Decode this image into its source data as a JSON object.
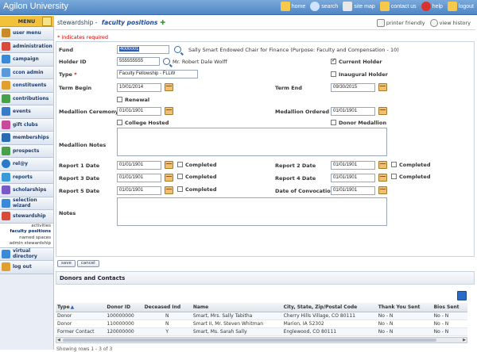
{
  "app": {
    "title": "Agilon University"
  },
  "topnav": [
    {
      "label": "home",
      "icon": "home-icon",
      "color": "#f7c94b"
    },
    {
      "label": "search",
      "icon": "search-icon",
      "color": "#cfe3ff"
    },
    {
      "label": "site map",
      "icon": "sitemap-icon",
      "color": "#e8e8e8"
    },
    {
      "label": "contact us",
      "icon": "mail-icon",
      "color": "#f7c94b"
    },
    {
      "label": "help",
      "icon": "help-icon",
      "color": "#d9342b"
    },
    {
      "label": "logout",
      "icon": "logout-icon",
      "color": "#f7c94b"
    }
  ],
  "sidebar": {
    "menu_label": "MENU",
    "items": [
      {
        "label": "user menu",
        "icon": "user-icon",
        "color": "#c98a2a"
      },
      {
        "label": "administration",
        "icon": "admin-icon",
        "color": "#d94a3a"
      },
      {
        "label": "campaign",
        "icon": "campaign-icon",
        "color": "#3a8ad9"
      },
      {
        "label": "ccon admin",
        "icon": "ccon-admin-icon",
        "color": "#5a9ad9"
      },
      {
        "label": "constituents",
        "icon": "constituents-icon",
        "color": "#e0a030"
      },
      {
        "label": "contributions",
        "icon": "contributions-icon",
        "color": "#4aa04a"
      },
      {
        "label": "events",
        "icon": "events-icon",
        "color": "#3a7ac9"
      },
      {
        "label": "gift clubs",
        "icon": "gift-clubs-icon",
        "color": "#c94a9a"
      },
      {
        "label": "memberships",
        "icon": "memberships-icon",
        "color": "#2a6ab0"
      },
      {
        "label": "prospects",
        "icon": "prospects-icon",
        "color": "#4aa04a"
      },
      {
        "label": "rel@y",
        "icon": "rely-icon",
        "color": "#2a7ac9"
      },
      {
        "label": "reports",
        "icon": "reports-icon",
        "color": "#3a9ad9"
      },
      {
        "label": "scholarships",
        "icon": "scholarships-icon",
        "color": "#7a5ac9"
      },
      {
        "label": "selection wizard",
        "icon": "wizard-icon",
        "color": "#3a8ad9"
      },
      {
        "label": "stewardship",
        "icon": "stewardship-icon",
        "color": "#d94a3a"
      }
    ],
    "subitems": [
      {
        "label": "activities",
        "active": false
      },
      {
        "label": "faculty positions",
        "active": true
      },
      {
        "label": "named spaces",
        "active": false
      },
      {
        "label": "admin stewardship",
        "active": false
      }
    ],
    "bottom_items": [
      {
        "label": "virtual directory",
        "icon": "directory-icon",
        "color": "#3a8ad9"
      },
      {
        "label": "log out",
        "icon": "logout-icon",
        "color": "#e0a030"
      }
    ]
  },
  "breadcrumb": {
    "section": "stewardship",
    "sep": " - ",
    "page": "faculty positions",
    "printer": "printer friendly",
    "history": "view history"
  },
  "required_note": "* indicates required",
  "form": {
    "fund_label": "Fund",
    "fund_value": "4000001",
    "fund_desc": "Sally Smart Endowed Chair for Finance (Purpose: Faculty and Compensation - 10)",
    "holder_id_label": "Holder ID",
    "holder_id_value": "555555555",
    "holder_name": "Mr. Robert Dale Wolff",
    "current_holder_label": "Current Holder",
    "current_holder_checked": true,
    "type_label": "Type",
    "type_value": "Faculty Fellowship - FLLW",
    "inaugural_holder_label": "Inaugural Holder",
    "inaugural_holder_checked": false,
    "term_begin_label": "Term Begin",
    "term_begin_value": "10/01/2014",
    "term_end_label": "Term End",
    "term_end_value": "09/30/2015",
    "renewal_label": "Renewal",
    "renewal_checked": false,
    "medallion_ceremony_label": "Medallion Ceremony",
    "medallion_ceremony_value": "01/01/1901",
    "medallion_ordered_label": "Medallion Ordered",
    "medallion_ordered_value": "01/01/1901",
    "college_hosted_label": "College Hosted",
    "college_hosted_checked": false,
    "donor_medallion_label": "Donor Medallion",
    "donor_medallion_checked": false,
    "medallion_notes_label": "Medallion Notes",
    "report1_label": "Report 1 Date",
    "report1_value": "01/01/1901",
    "report2_label": "Report 2 Date",
    "report2_value": "01/01/1901",
    "report3_label": "Report 3 Date",
    "report3_value": "01/01/1901",
    "report4_label": "Report 4 Date",
    "report4_value": "01/01/1901",
    "report5_label": "Report 5 Date",
    "report5_value": "01/01/1901",
    "convocation_label": "Date of Convocation",
    "convocation_value": "01/01/1901",
    "completed_label": "Completed",
    "notes_label": "Notes"
  },
  "buttons": {
    "save": "save",
    "cancel": "cancel"
  },
  "donors_panel_title": "Donors and Contacts",
  "table": {
    "headers": [
      "Type",
      "Donor ID",
      "Deceased Ind",
      "Name",
      "City, State, Zip/Postal Code",
      "Thank You Sent",
      "Bios Sent"
    ],
    "rows": [
      [
        "Donor",
        "100000000",
        "N",
        "Smart, Mrs. Sally Tabitha",
        "Cherry Hills Village, CO 80111",
        "No - N",
        "No - N"
      ],
      [
        "Donor",
        "110000000",
        "N",
        "Smart II, Mr. Steven Whitman",
        "Marion, IA 52302",
        "No - N",
        "No - N"
      ],
      [
        "Former Contact",
        "120000000",
        "Y",
        "Smart, Ms. Sarah Sally",
        "Englewood, CO 80111",
        "No - N",
        "No - N"
      ]
    ],
    "showing": "Showing rows 1 - 3 of 3"
  }
}
